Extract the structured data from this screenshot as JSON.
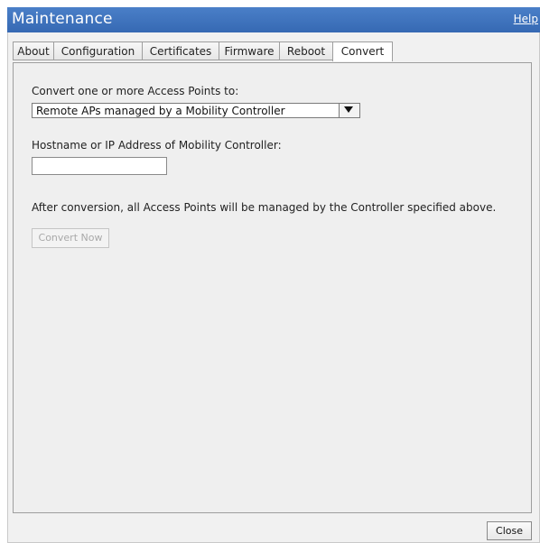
{
  "window": {
    "title": "Maintenance",
    "help_label": "Help"
  },
  "tabs": [
    {
      "label": "About"
    },
    {
      "label": "Configuration"
    },
    {
      "label": "Certificates"
    },
    {
      "label": "Firmware"
    },
    {
      "label": "Reboot"
    },
    {
      "label": "Convert",
      "active": true
    }
  ],
  "convert": {
    "convert_to_label": "Convert one or more Access Points to:",
    "convert_to_value": "Remote APs managed by a Mobility Controller",
    "controller_label": "Hostname or IP Address of Mobility Controller:",
    "controller_value": "",
    "note": "After conversion, all Access Points will be managed by the Controller specified above.",
    "convert_button_label": "Convert Now",
    "convert_button_enabled": false
  },
  "footer": {
    "close_label": "Close"
  },
  "colors": {
    "titlebar": "#3669b3",
    "panel": "#efefef"
  }
}
